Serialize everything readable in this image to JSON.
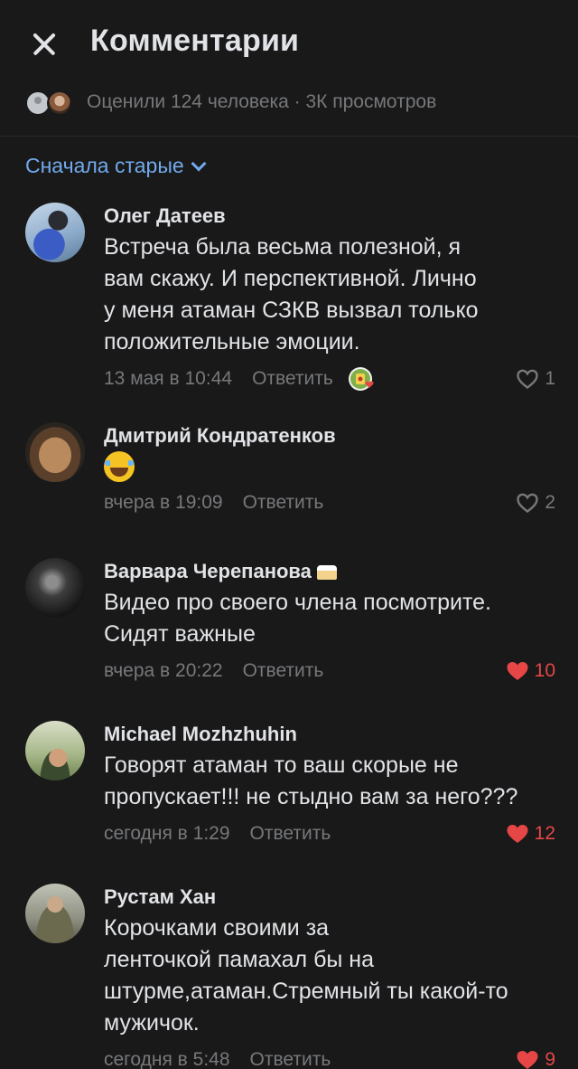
{
  "header": {
    "title": "Комментарии"
  },
  "likes_summary": {
    "text": "Оценили 124 человека · 3К просмотров"
  },
  "sort": {
    "label": "Сначала старые"
  },
  "colors": {
    "accent": "#71aaeb",
    "like_active": "#e64646",
    "secondary_text": "#76787a",
    "background": "#19191a"
  },
  "comments": [
    {
      "author": "Олег Датеев",
      "lines": [
        "Встреча была весьма полезной, я",
        "вам скажу.  И перспективной. Лично",
        "у меня атаман СЗКВ вызвал только",
        "положительные эмоции."
      ],
      "date": "13 мая в 10:44",
      "reply": "Ответить",
      "likes": "1",
      "liked": false,
      "has_sticker_reaction": true
    },
    {
      "author": "Дмитрий Кондратенков",
      "emoji": "face-with-tears-of-joy",
      "date": "вчера в 19:09",
      "reply": "Ответить",
      "likes": "2",
      "liked": false
    },
    {
      "author": "Варвара Черепанова",
      "author_badge": "cake-icon",
      "lines": [
        "Видео про своего члена посмотрите.",
        "Сидят важные"
      ],
      "date": "вчера в 20:22",
      "reply": "Ответить",
      "likes": "10",
      "liked": true
    },
    {
      "author": "Michael Mozhzhuhin",
      "lines": [
        "Говорят атаман то ваш скорые не",
        "пропускает!!! не стыдно вам за него???"
      ],
      "date": "сегодня в 1:29",
      "reply": "Ответить",
      "likes": "12",
      "liked": true
    },
    {
      "author": "Рустам Хан",
      "lines": [
        "Корочками своими за",
        "ленточкой памахал бы на",
        "штурме,атаман.Стремный ты какой-то",
        "мужичок."
      ],
      "date": "сегодня в 5:48",
      "reply": "Ответить",
      "likes": "9",
      "liked": true
    }
  ]
}
